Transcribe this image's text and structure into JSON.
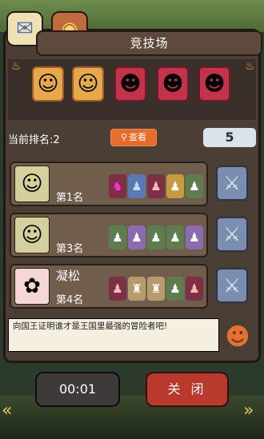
{
  "title": "竞技场",
  "header_icons": [
    "mail-icon",
    "reward-bag-icon"
  ],
  "current_rank_label": "当前排名:2",
  "view_button_label": "查看",
  "challenge_count": "5",
  "opponents": [
    {
      "name": "",
      "rank": "第1名",
      "avatar": "knight-avatar"
    },
    {
      "name": "",
      "rank": "第3名",
      "avatar": "knight-avatar"
    },
    {
      "name": "凝松",
      "rank": "第4名",
      "avatar": "pink-creature-avatar"
    }
  ],
  "message": "向国王证明谁才是王国里最强的冒险者吧!",
  "timer": "00:01",
  "close_label": "关 闭",
  "colors": {
    "accent": "#e86d2a",
    "close": "#b93a2d",
    "panel": "#4a3e35"
  }
}
